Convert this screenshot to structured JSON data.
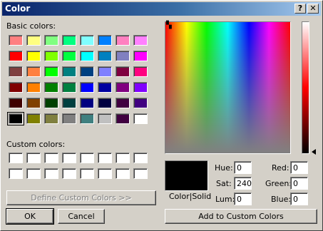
{
  "window": {
    "title": "Color",
    "help": "?",
    "close": "✕"
  },
  "basic": {
    "label": "Basic colors:",
    "colors": [
      "#ff8080",
      "#ffff80",
      "#80ff80",
      "#00ff80",
      "#80ffff",
      "#0080ff",
      "#ff80c0",
      "#ff80ff",
      "#ff0000",
      "#ffff00",
      "#80ff00",
      "#00ff40",
      "#00ffff",
      "#0080c0",
      "#8080c0",
      "#ff00ff",
      "#804040",
      "#ff8040",
      "#00ff00",
      "#008080",
      "#004080",
      "#8080ff",
      "#800040",
      "#ff0080",
      "#800000",
      "#ff8000",
      "#008000",
      "#008040",
      "#0000ff",
      "#0000a0",
      "#800080",
      "#8000ff",
      "#400000",
      "#804000",
      "#004000",
      "#004040",
      "#000080",
      "#000040",
      "#400040",
      "#400080",
      "#000000",
      "#808000",
      "#808040",
      "#808080",
      "#408080",
      "#c0c0c0",
      "#400040",
      "#ffffff"
    ]
  },
  "custom": {
    "label": "Custom colors:",
    "colors": [
      "#ffffff",
      "#ffffff",
      "#ffffff",
      "#ffffff",
      "#ffffff",
      "#ffffff",
      "#ffffff",
      "#ffffff",
      "#ffffff",
      "#ffffff",
      "#ffffff",
      "#ffffff",
      "#ffffff",
      "#ffffff",
      "#ffffff",
      "#ffffff"
    ]
  },
  "buttons": {
    "define": "Define Custom Colors >>",
    "ok": "OK",
    "cancel": "Cancel",
    "add": "Add to Custom Colors"
  },
  "color_solid": "Color|Solid",
  "fields": {
    "hue": {
      "label": "Hue:",
      "value": "0"
    },
    "sat": {
      "label": "Sat:",
      "value": "240"
    },
    "lum": {
      "label": "Lum:",
      "value": "0"
    },
    "red": {
      "label": "Red:",
      "value": "0"
    },
    "green": {
      "label": "Green:",
      "value": "0"
    },
    "blue": {
      "label": "Blue:",
      "value": "0"
    }
  },
  "current_color": "#000000"
}
